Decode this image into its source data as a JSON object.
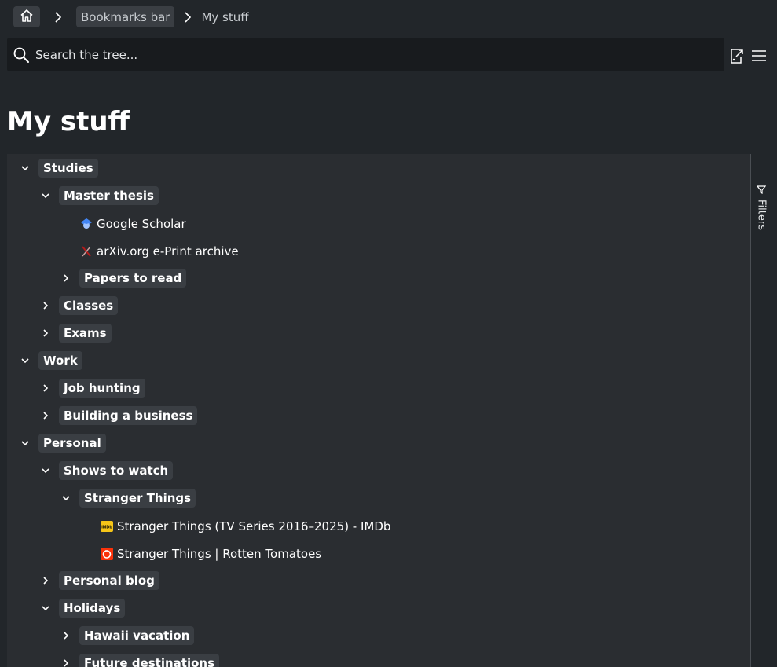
{
  "breadcrumb": {
    "home_icon": "home-icon",
    "items": [
      "Bookmarks bar",
      "My stuff"
    ]
  },
  "search": {
    "placeholder": "Search the tree..."
  },
  "toolbar": {
    "icons": [
      "export-icon",
      "menu-icon"
    ]
  },
  "page": {
    "title": "My stuff"
  },
  "tree": {
    "studies": "Studies",
    "master_thesis": "Master thesis",
    "google_scholar": "Google Scholar",
    "arxiv": "arXiv.org e-Print archive",
    "papers_to_read": "Papers to read",
    "classes": "Classes",
    "exams": "Exams",
    "work": "Work",
    "job_hunting": "Job hunting",
    "building_business": "Building a business",
    "personal": "Personal",
    "shows_to_watch": "Shows to watch",
    "stranger_things": "Stranger Things",
    "st_imdb": "Stranger Things (TV Series 2016–2025) - IMDb",
    "st_rotten": "Stranger Things | Rotten Tomatoes",
    "personal_blog": "Personal blog",
    "holidays": "Holidays",
    "hawaii": "Hawaii vacation",
    "future_destinations": "Future destinations"
  },
  "favicons": {
    "imdb_text": "IMDb"
  },
  "filters": {
    "label": "Filters"
  },
  "colors": {
    "background": "#22262a",
    "panel": "#2a2d31",
    "folder_chip": "#3a3e43",
    "search_bg": "#181b1e",
    "imdb_yellow": "#f5c518",
    "rotten_red": "#fa320a",
    "scholar_blue": "#4285f4",
    "arxiv_red": "#b31b1b"
  }
}
